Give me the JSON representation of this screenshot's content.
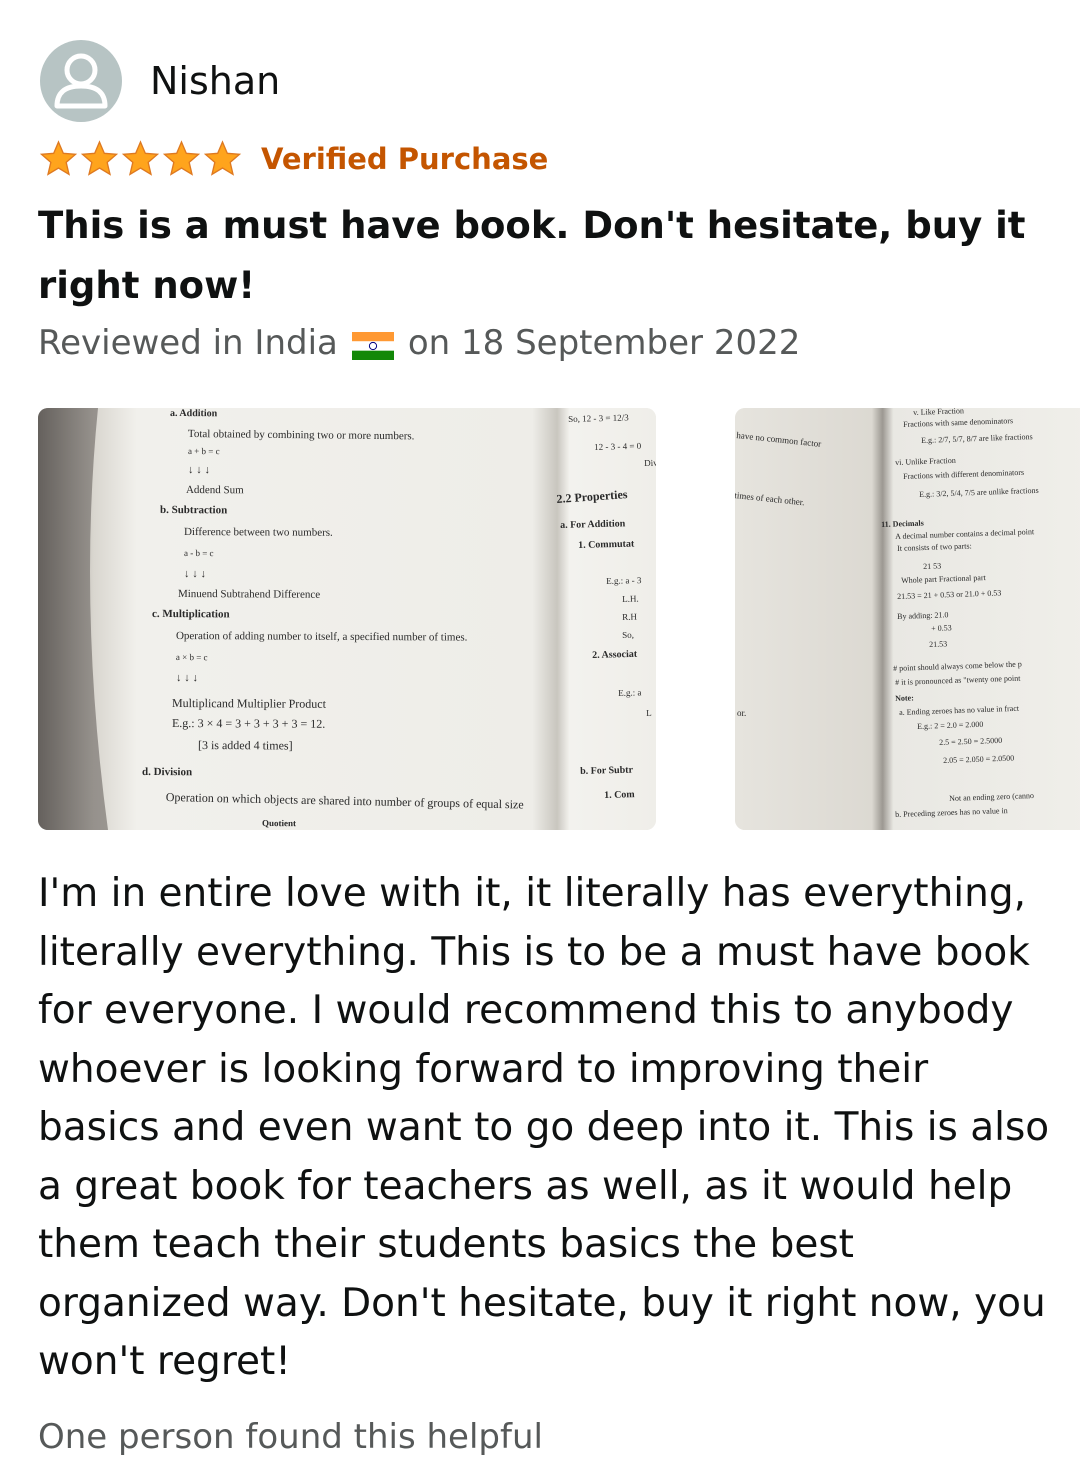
{
  "review": {
    "username": "Nishan",
    "rating": 5,
    "rating_max": 5,
    "verified_label": "Verified Purchase",
    "title": "This is a must have book. Don't hesitate, buy it right now!",
    "meta_prefix": "Reviewed in India",
    "meta_suffix": "on 18 September 2022",
    "body": "I'm in entire love with it, it literally has everything, literally everything. This is to be a must have book for everyone. I would recommend this to anybody whoever is looking forward to improving their basics and even want to go deep into it. This is also a great book for teachers as well, as it would help them teach their students basics the best organized way. Don't hesitate, buy it right now, you won't regret!",
    "helpful_text": "One person found this helpful"
  },
  "icons": {
    "avatar": "user-avatar-icon",
    "star": "star-icon",
    "flag": "india-flag-icon"
  },
  "colors": {
    "star": "#ffa41c",
    "verified": "#c45500",
    "muted": "#565959",
    "avatar_bg": "#b7c4c4"
  },
  "photo1": {
    "lines": [
      "a.  Addition",
      "Total obtained by combining two or more numbers.",
      "a  +  b  =  c",
      "↓    ↓      ↓",
      "Addend      Sum",
      "b.  Subtraction",
      "Difference between two numbers.",
      "a        -        b        =        c",
      "↓                   ↓                    ↓",
      "Minuend     Subtrahend          Difference",
      "c.  Multiplication",
      "Operation of adding number to itself, a specified number of times.",
      "a        ×        b        =        c",
      "↓                   ↓                    ↓",
      "Multiplicand    Multiplier              Product",
      "E.g.: 3 × 4 = 3 + 3 + 3 + 3 = 12.",
      "[3 is added 4 times]",
      "d.  Division",
      "Operation on which objects are shared into number of groups of equal size",
      "Quotient"
    ],
    "side_lines": [
      "So, 12 - 3 = 12/3",
      "12 - 3 - 4 = 0",
      "Div",
      "2.2 Properties",
      "a.  For Addition",
      "1.  Commutat",
      "E.g.: a - 3",
      "L.H.",
      "R.H",
      "So,",
      "2.  Associat",
      "E.g.: a",
      "L",
      "b.  For Subtr",
      "1.  Com"
    ]
  },
  "photo2": {
    "left_lines": [
      "have no common factor",
      "times of each other.",
      "or."
    ],
    "lines": [
      "v.  Like Fraction",
      "Fractions with same denominators",
      "E.g.: 2/7, 5/7, 8/7 are like fractions",
      "vi.  Unlike Fraction",
      "Fractions with different denominators",
      "E.g.: 3/2, 5/4, 7/5 are unlike fractions",
      "11.  Decimals",
      "A decimal number contains a decimal point",
      "It consists of two parts:",
      "21          53",
      "Whole part     Fractional part",
      "21.53 = 21 + 0.53 or 21.0 + 0.53",
      "By adding:  21.0",
      "+ 0.53",
      "21.53",
      "# point should always come below the p",
      "# it is pronounced as \"twenty one point",
      "Note:",
      "a.  Ending zeroes has no value in fract",
      "E.g.: 2 = 2.0 = 2.000",
      "2.5 = 2.50 = 2.5000",
      "2.05 = 2.050 = 2.0500",
      "Not an ending zero (canno",
      "b.  Preceding zeroes has no value in"
    ]
  }
}
